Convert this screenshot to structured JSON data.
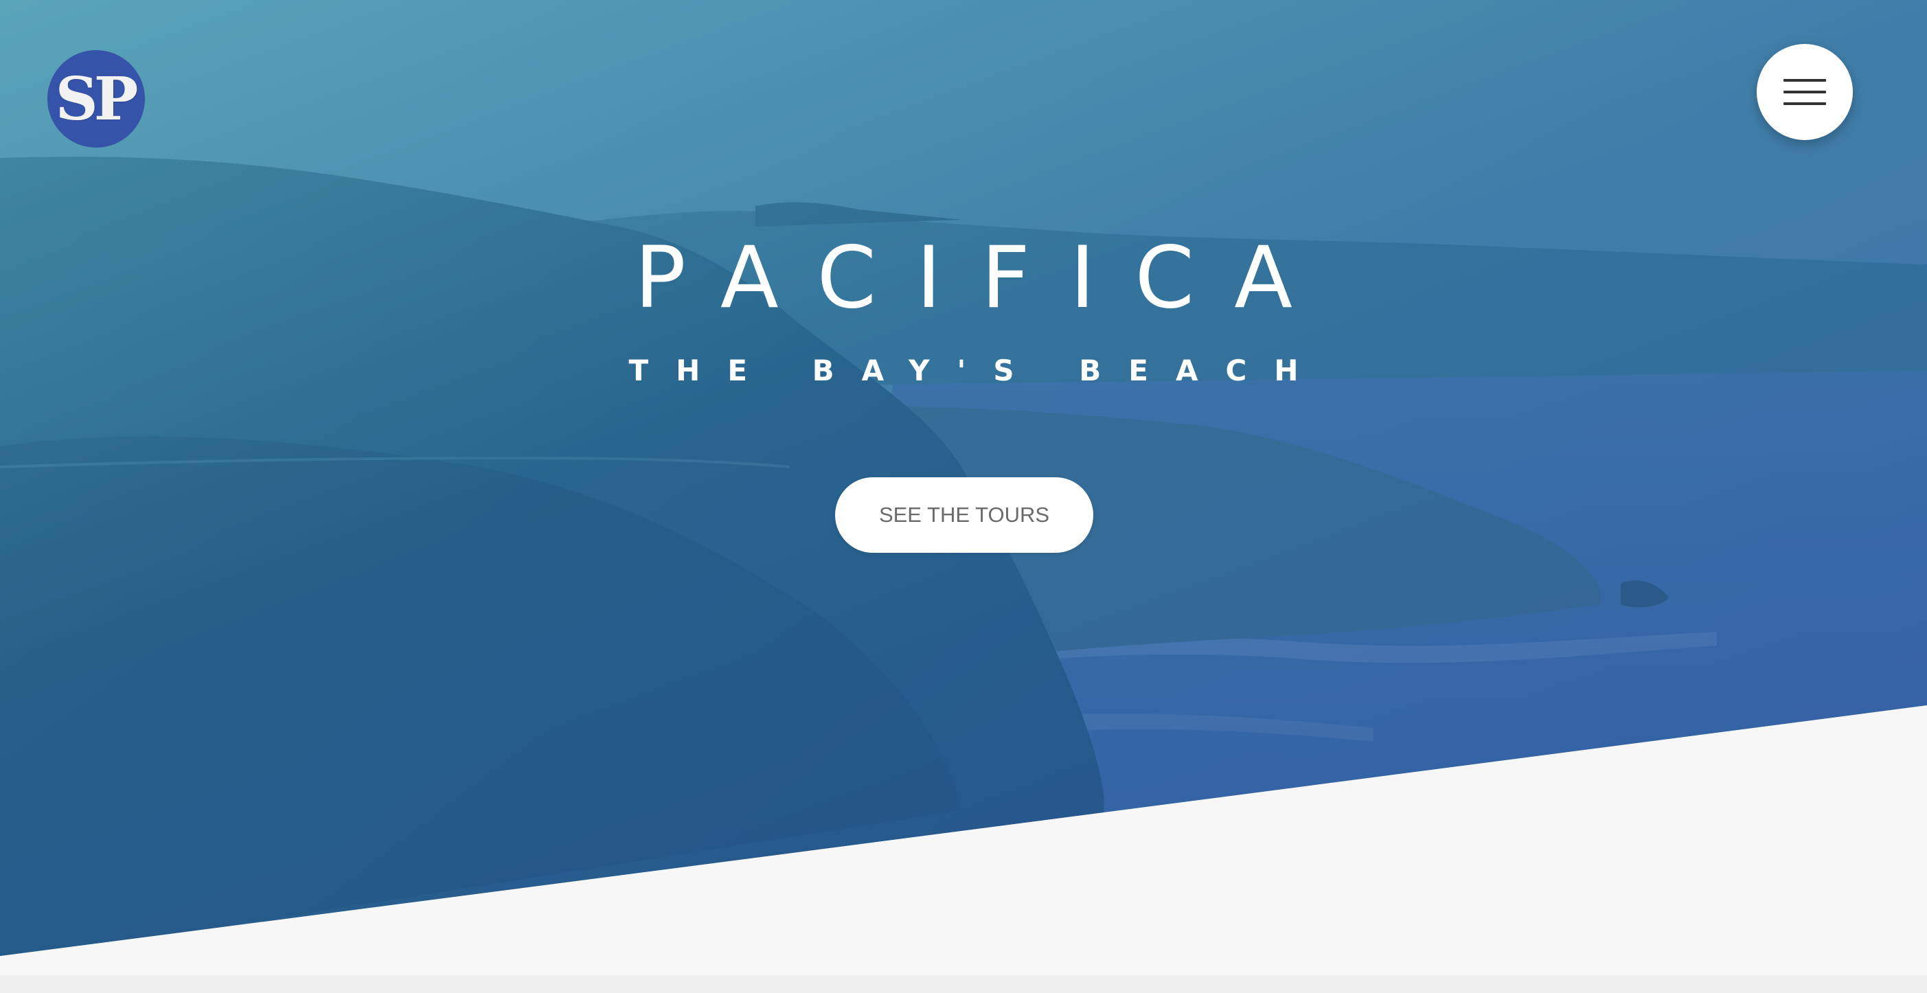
{
  "brand": {
    "logo_text": "SP",
    "logo_color": "#3553a8"
  },
  "nav": {
    "menu_icon": "hamburger-menu-icon"
  },
  "hero": {
    "title": "PACIFICA",
    "subtitle": "THE BAY'S BEACH",
    "cta_label": "SEE THE TOURS",
    "overlay_color": "#2f6aa0"
  }
}
